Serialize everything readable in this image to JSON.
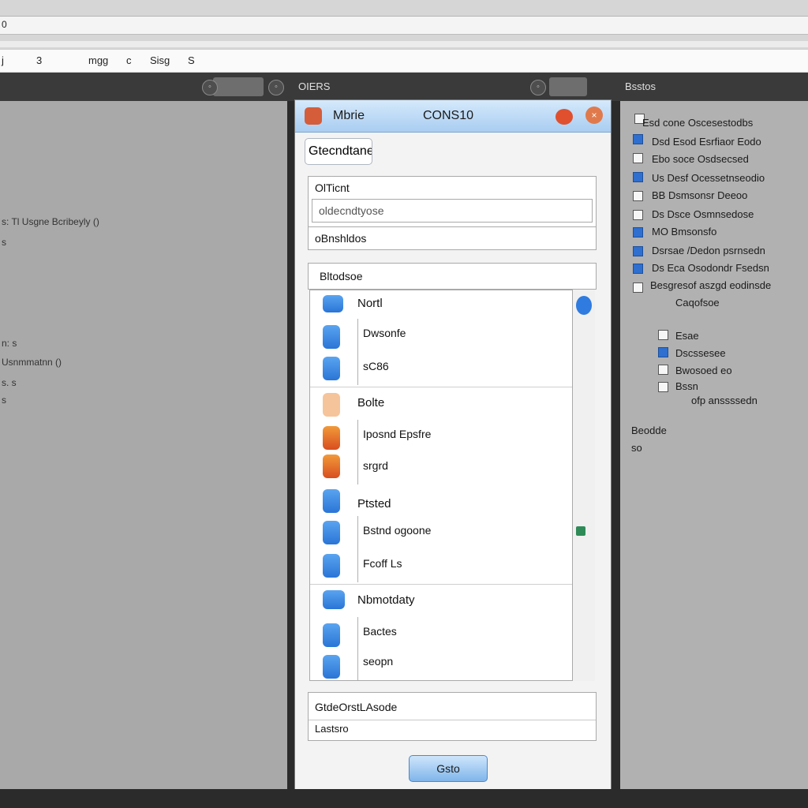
{
  "topbar": {
    "address_value": "0",
    "toolbar": [
      "j",
      "3",
      "mgg",
      "c",
      "Sisg",
      "S"
    ]
  },
  "darkbar": {
    "center_label": "OIERS",
    "right_label": "Bsstos"
  },
  "left_panel": {
    "lines": [
      "s: Tl Usgne Bcribeyly ()",
      "s",
      "n: s",
      "Usnmmatnn ()",
      "s. s",
      "s"
    ]
  },
  "dialog": {
    "title_left": "Mbrie",
    "title_right": "CONS10",
    "tab_label": "Gtecndtane",
    "fields": {
      "name_label": "OlTicnt",
      "name_value": "oldecndtyose",
      "search_value": "oBnshldos",
      "section_label": "Bltodsoe"
    },
    "list": {
      "groups": [
        {
          "header": "Nortl",
          "items": [
            "Dwsonfe",
            "sC86"
          ]
        },
        {
          "header": "Bolte",
          "items": [
            "Iposnd Epsfre",
            "srgrd"
          ]
        },
        {
          "header": "Ptsted",
          "items": [
            "Bstnd ogoone",
            "Fcoff Ls"
          ]
        },
        {
          "header": "Nbmotdaty",
          "items": [
            "Bactes",
            "seopn"
          ]
        }
      ]
    },
    "footer": {
      "line1": "GtdeOrstLAsode",
      "line2": "Lastsro"
    },
    "ok_label": "Gsto"
  },
  "right_panel": {
    "rows": [
      "Esd cone Oscesestodbs",
      "Dsd Esod Esrfiaor Eodo",
      "Ebo soce Osdsecsed",
      "Us Desf Ocessetnseodio",
      "BB Dsmsonsr Deeoo",
      "Ds Dsce Osmnsedose",
      "MO Bmsonsfo",
      "Dsrsae /Dedon psrnsedn",
      "Ds Eca Osodondr Fsedsn",
      "Besgresof aszgd eodinsde",
      "Caqofsoe",
      "Esae",
      "Dscssesee",
      "Bwosoed eo",
      "Bssn",
      "ofp anssssedn"
    ],
    "checked_rows": [
      1,
      3,
      7,
      8,
      12
    ],
    "note1": "Beodde",
    "note2": "so"
  }
}
